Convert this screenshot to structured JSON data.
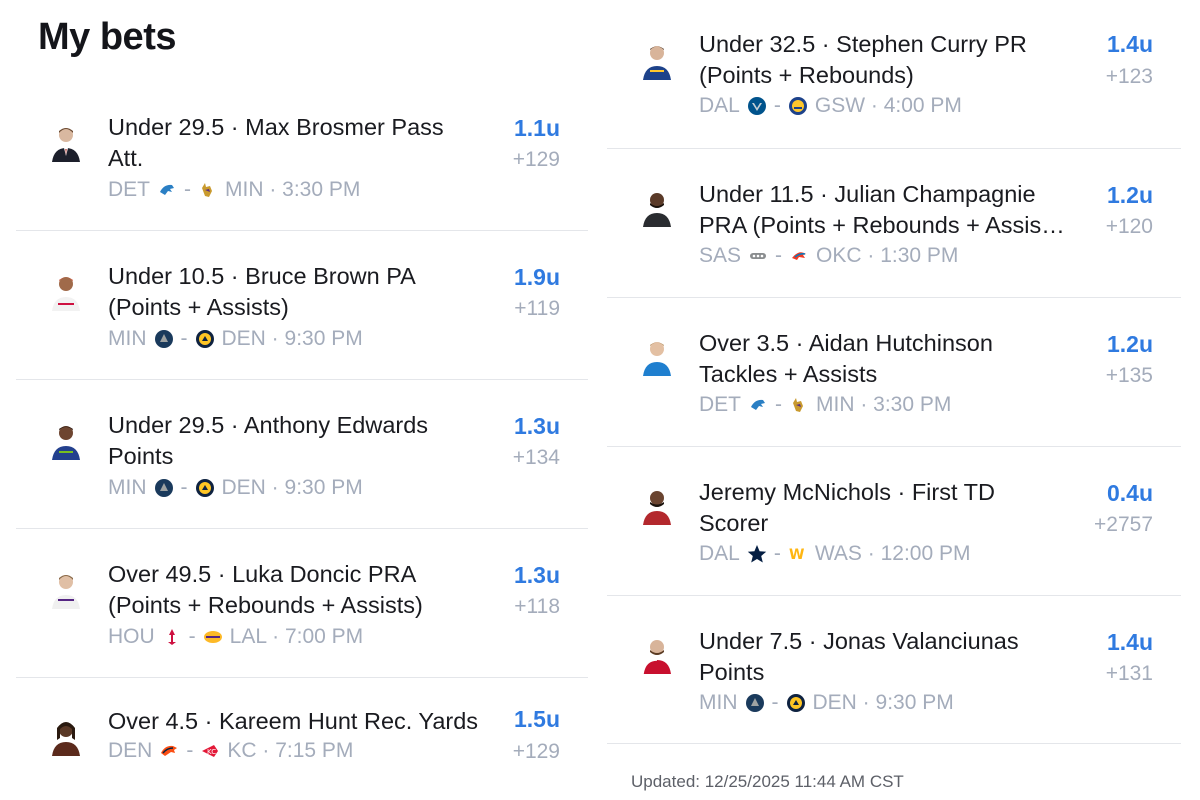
{
  "page_title": "My bets",
  "updated_text": "Updated: 12/25/2025 11:44 AM CST",
  "colors": {
    "units_blue": "#2f7ae0",
    "muted_gray": "#a4acbb",
    "divider": "#e4e6ea"
  },
  "left_bets": [
    {
      "title": "Under 29.5 · Max Brosmer Pass\nAtt.",
      "units": "1.1u",
      "odds": "+129",
      "away": "DET",
      "home": "MIN",
      "time": "3:30 PM",
      "away_logo": "lions-logo-icon",
      "home_logo": "vikings-logo-icon",
      "avatar": "player-avatar-icon"
    },
    {
      "title": "Under 10.5 · Bruce Brown PA\n(Points + Assists)",
      "units": "1.9u",
      "odds": "+119",
      "away": "MIN",
      "home": "DEN",
      "time": "9:30 PM",
      "away_logo": "timberwolves-logo-icon",
      "home_logo": "nuggets-logo-icon",
      "avatar": "player-avatar-icon"
    },
    {
      "title": "Under 29.5 · Anthony Edwards\nPoints",
      "units": "1.3u",
      "odds": "+134",
      "away": "MIN",
      "home": "DEN",
      "time": "9:30 PM",
      "away_logo": "timberwolves-logo-icon",
      "home_logo": "nuggets-logo-icon",
      "avatar": "player-avatar-icon"
    },
    {
      "title": "Over 49.5 · Luka Doncic PRA\n(Points + Rebounds + Assists)",
      "units": "1.3u",
      "odds": "+118",
      "away": "HOU",
      "home": "LAL",
      "time": "7:00 PM",
      "away_logo": "rockets-logo-icon",
      "home_logo": "lakers-logo-icon",
      "avatar": "player-avatar-icon"
    },
    {
      "title": "Over 4.5 · Kareem Hunt Rec. Yards",
      "units": "1.5u",
      "odds": "+129",
      "away": "DEN",
      "home": "KC",
      "time": "7:15 PM",
      "away_logo": "broncos-logo-icon",
      "home_logo": "chiefs-logo-icon",
      "avatar": "player-avatar-icon"
    }
  ],
  "right_bets": [
    {
      "title": "Under 32.5 · Stephen Curry PR\n(Points + Rebounds)",
      "units": "1.4u",
      "odds": "+123",
      "away": "DAL",
      "home": "GSW",
      "time": "4:00 PM",
      "away_logo": "mavericks-logo-icon",
      "home_logo": "warriors-logo-icon",
      "avatar": "player-avatar-icon"
    },
    {
      "title": "Under 11.5 · Julian Champagnie\nPRA (Points + Rebounds + Assis…",
      "units": "1.2u",
      "odds": "+120",
      "away": "SAS",
      "home": "OKC",
      "time": "1:30 PM",
      "away_logo": "spurs-logo-icon",
      "home_logo": "thunder-logo-icon",
      "avatar": "player-avatar-icon"
    },
    {
      "title": "Over 3.5 · Aidan Hutchinson\nTackles + Assists",
      "units": "1.2u",
      "odds": "+135",
      "away": "DET",
      "home": "MIN",
      "time": "3:30 PM",
      "away_logo": "lions-logo-icon",
      "home_logo": "vikings-logo-icon",
      "avatar": "player-avatar-icon"
    },
    {
      "title": "Jeremy McNichols · First TD\nScorer",
      "units": "0.4u",
      "odds": "+2757",
      "away": "DAL",
      "home": "WAS",
      "time": "12:00 PM",
      "away_logo": "cowboys-logo-icon",
      "home_logo": "commanders-logo-icon",
      "avatar": "player-avatar-icon"
    },
    {
      "title": "Under 7.5 · Jonas Valanciunas\nPoints",
      "units": "1.4u",
      "odds": "+131",
      "away": "MIN",
      "home": "DEN",
      "time": "9:30 PM",
      "away_logo": "timberwolves-logo-icon",
      "home_logo": "nuggets-logo-icon",
      "avatar": "player-avatar-icon"
    }
  ]
}
